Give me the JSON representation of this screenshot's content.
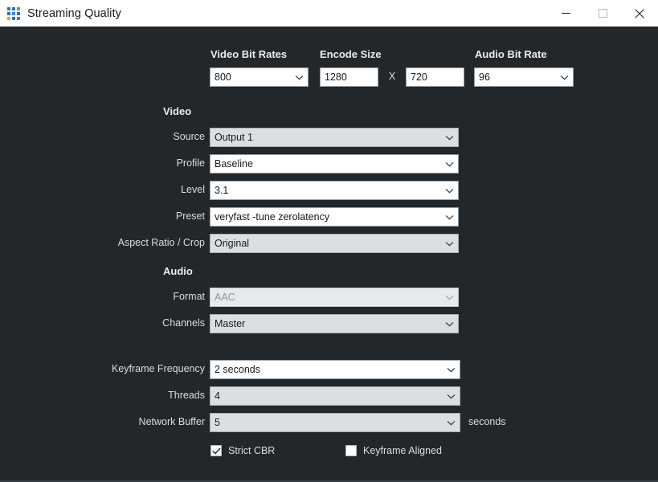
{
  "window": {
    "title": "Streaming Quality",
    "icon": "app-grid-icon",
    "controls": {
      "minimize": "minimize-icon",
      "maximize": "maximize-icon",
      "close": "close-icon"
    },
    "colors": {
      "titlebar_bg": "#ffffff",
      "content_bg": "#22272b",
      "label_text": "#d9dee2",
      "field_bg": "#ffffff",
      "field_bg_gray": "#dcdfe2",
      "field_bg_disabled": "#e7eaec",
      "field_border": "#9aa0a6"
    }
  },
  "top_row": {
    "video_bit_rates": {
      "label": "Video Bit Rates",
      "value": "800",
      "type": "combobox"
    },
    "encode_size": {
      "label": "Encode Size",
      "width_value": "1280",
      "separator": "X",
      "height_value": "720",
      "type": "text-inputs"
    },
    "audio_bit_rate": {
      "label": "Audio Bit Rate",
      "value": "96",
      "type": "combobox"
    }
  },
  "video_section": {
    "header": "Video",
    "rows": [
      {
        "label": "Source",
        "value": "Output 1",
        "state": "gray"
      },
      {
        "label": "Profile",
        "value": "Baseline",
        "state": "normal"
      },
      {
        "label": "Level",
        "value": "3.1",
        "state": "normal"
      },
      {
        "label": "Preset",
        "value": "veryfast -tune zerolatency",
        "state": "normal"
      },
      {
        "label": "Aspect Ratio / Crop",
        "value": "Original",
        "state": "gray"
      }
    ]
  },
  "audio_section": {
    "header": "Audio",
    "rows": [
      {
        "label": "Format",
        "value": "AAC",
        "state": "disabled"
      },
      {
        "label": "Channels",
        "value": "Master",
        "state": "gray"
      }
    ]
  },
  "advanced_section": {
    "rows": [
      {
        "label": "Keyframe Frequency",
        "value": "2 seconds",
        "state": "normal",
        "suffix": ""
      },
      {
        "label": "Threads",
        "value": "4",
        "state": "gray",
        "suffix": ""
      },
      {
        "label": "Network Buffer",
        "value": "5",
        "state": "gray",
        "suffix": "seconds"
      }
    ]
  },
  "checkboxes": [
    {
      "label": "Strict CBR",
      "checked": true
    },
    {
      "label": "Keyframe Aligned",
      "checked": false
    }
  ]
}
